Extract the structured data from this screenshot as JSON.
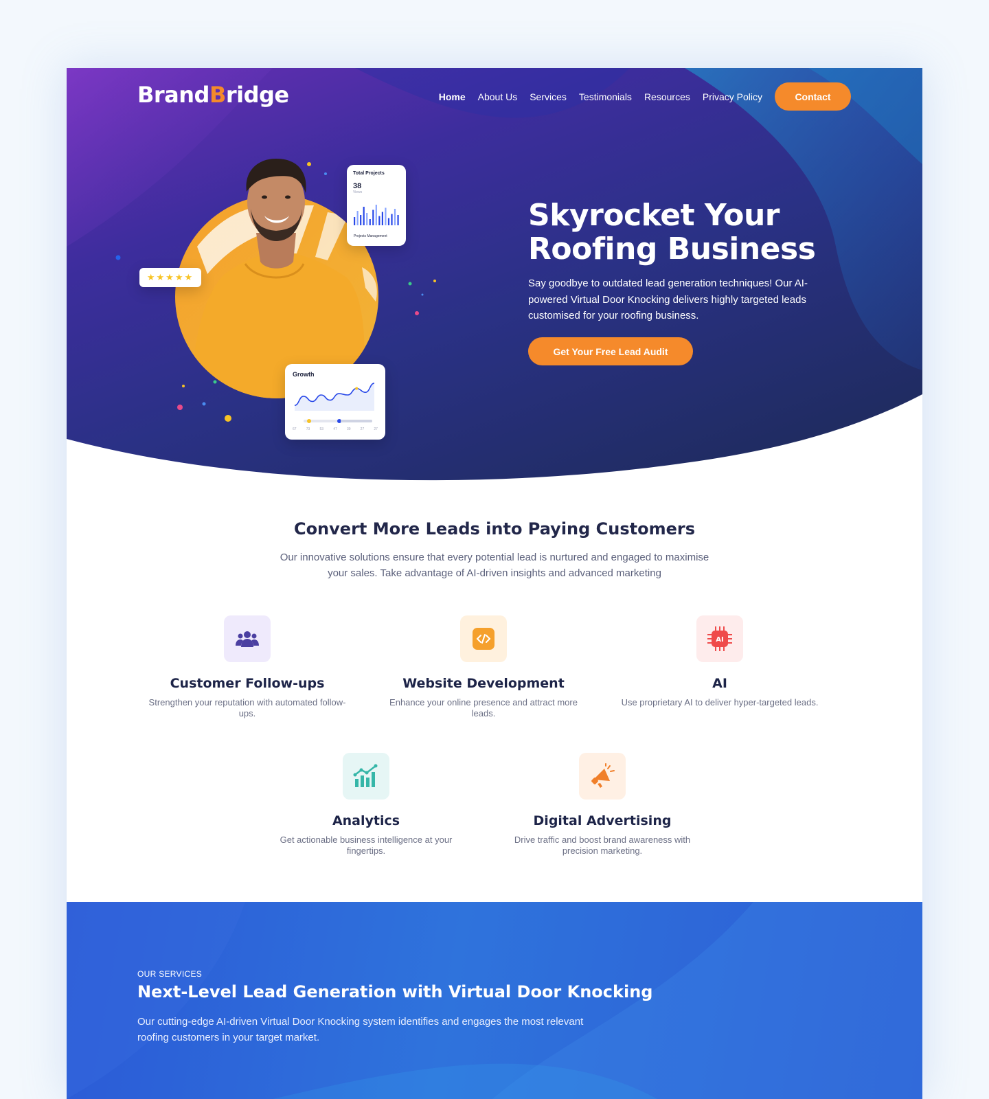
{
  "brand": {
    "part1": "Brand",
    "part2": "B",
    "part3": "ridge"
  },
  "nav": {
    "items": [
      "Home",
      "About Us",
      "Services",
      "Testimonials",
      "Resources",
      "Privacy Policy"
    ],
    "contact": "Contact"
  },
  "hero": {
    "title": "Skyrocket Your Roofing Business",
    "text": "Say goodbye to outdated lead generation techniques! Our AI-powered Virtual Door Knocking delivers highly targeted leads customised for your roofing business.",
    "cta": "Get Your Free Lead Audit",
    "rating_stars": "★★★★★",
    "projects_card": {
      "title": "Total Projects",
      "value": "38",
      "sub": "Views",
      "footer": "Projects Management",
      "bars": [
        8,
        14,
        10,
        18,
        12,
        6,
        15,
        20,
        9,
        13,
        17,
        7,
        11,
        16,
        10
      ]
    },
    "growth_card": {
      "title": "Growth",
      "ticks": [
        "67",
        "73",
        "53",
        "47",
        "39",
        "27",
        "27"
      ],
      "line": [
        0.1,
        0.45,
        0.25,
        0.5,
        0.3,
        0.55,
        0.5,
        0.75,
        0.6,
        0.95
      ]
    }
  },
  "convert": {
    "title": "Convert More Leads into Paying Customers",
    "subtitle": "Our innovative solutions ensure that every potential lead is nurtured and engaged to maximise your sales. Take advantage of AI-driven insights and advanced marketing",
    "features": [
      {
        "icon": "users-icon",
        "title": "Customer Follow-ups",
        "text": "Strengthen your reputation with automated follow-ups.",
        "bg": "#efeafc",
        "color": "#4b3fa1"
      },
      {
        "icon": "code-icon",
        "title": "Website Development",
        "text": "Enhance your online presence and attract more leads.",
        "bg": "#fff1de",
        "color": "#f59a2b"
      },
      {
        "icon": "ai-chip-icon",
        "title": "AI",
        "text": "Use proprietary AI to deliver hyper-targeted leads.",
        "bg": "#feecec",
        "color": "#ef4a4a"
      },
      {
        "icon": "analytics-chart-icon",
        "title": "Analytics",
        "text": "Get actionable business intelligence at your fingertips.",
        "bg": "#e6f6f5",
        "color": "#35b6a8"
      },
      {
        "icon": "megaphone-icon",
        "title": "Digital Advertising",
        "text": "Drive traffic and boost brand awareness with precision marketing.",
        "bg": "#fff0e4",
        "color": "#f07f2a"
      }
    ]
  },
  "services": {
    "kicker": "OUR SERVICES",
    "title": "Next-Level Lead Generation with Virtual Door Knocking",
    "text": "Our cutting-edge AI-driven Virtual Door Knocking system identifies and engages the most relevant roofing customers in your target market."
  },
  "colors": {
    "accent": "#f58a2b",
    "navy": "#1d2448",
    "services_blue": "#2f73dc"
  }
}
